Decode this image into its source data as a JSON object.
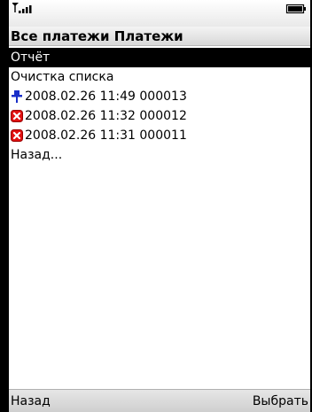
{
  "status": {
    "signal_icon": "signal-strength-icon",
    "battery_icon": "battery-icon"
  },
  "title": "Все платежи Платежи",
  "list": {
    "items": [
      {
        "label": "Отчёт",
        "selected": true
      },
      {
        "label": "Очистка списка"
      },
      {
        "label": "2008.02.26 11:49 000013",
        "icon": "pin-icon"
      },
      {
        "label": "2008.02.26 11:32 000012",
        "icon": "error-icon"
      },
      {
        "label": "2008.02.26 11:31 000011",
        "icon": "error-icon"
      },
      {
        "label": "Назад..."
      }
    ]
  },
  "softkeys": {
    "left": "Назад",
    "right": "Выбрать"
  },
  "colors": {
    "selection": "#000000",
    "pin": "#1a2fc8",
    "error": "#e01010"
  }
}
